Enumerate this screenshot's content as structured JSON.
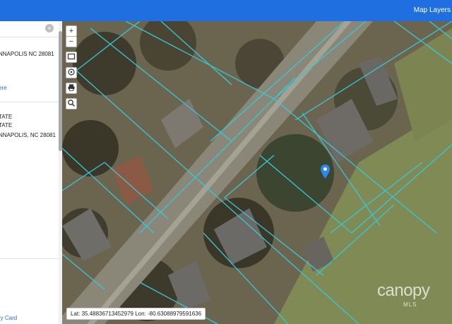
{
  "header": {
    "layers_link": "Map Layers"
  },
  "sidebar": {
    "close_label": "×",
    "result1_city": "NNAPOLIS NC 28081",
    "result1_link": "ere",
    "result2_line1": "TATE",
    "result2_line2": "TATE",
    "result2_city": "NNAPOLIS, NC 28081",
    "footer_link": "ry Card"
  },
  "map": {
    "zoom_in": "+",
    "zoom_out": "−",
    "coordinates": "Lat: 35.48836713452979 Lon: -80.63088979591636",
    "watermark": "canopy",
    "watermark_sub": "MLS",
    "icons": [
      "plus-icon",
      "minus-icon",
      "rectangle-select-icon",
      "locate-icon",
      "print-icon",
      "search-icon",
      "location-pin-icon",
      "close-icon"
    ],
    "parcel_line_color": "#37c8d8",
    "pin_color": "#2f86f0"
  }
}
